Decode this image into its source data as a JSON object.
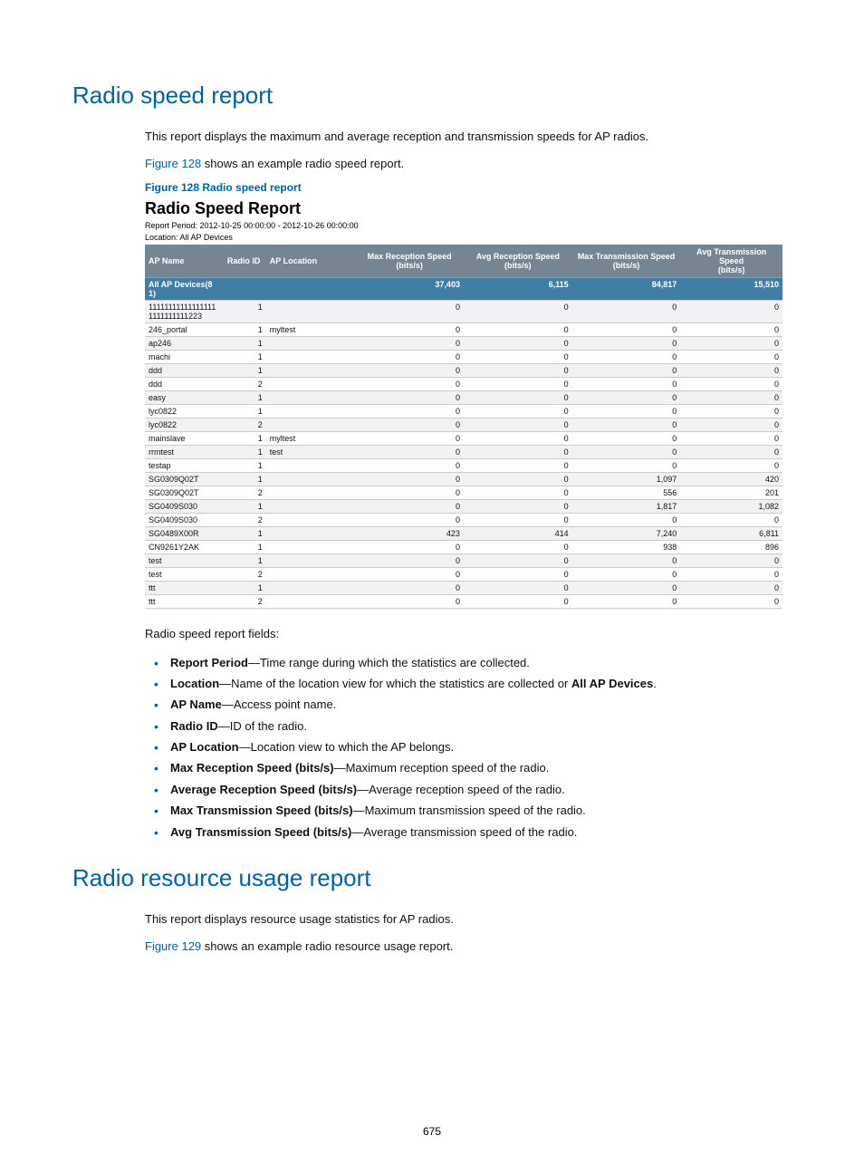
{
  "section1": {
    "title": "Radio speed report",
    "intro": "This report displays the maximum and average reception and transmission speeds for AP radios.",
    "figref": "Figure 128",
    "figref_rest": " shows an example radio speed report.",
    "figcaption": "Figure 128 Radio speed report",
    "reportTitle": "Radio Speed Report",
    "reportPeriod": "Report Period: 2012-10-25 00:00:00  -  2012-10-26 00:00:00",
    "location": "Location: All AP Devices"
  },
  "section2": {
    "title": "Radio resource usage report",
    "intro": "This report displays resource usage statistics for AP radios.",
    "figref": "Figure 129",
    "figref_rest": " shows an example radio resource usage report."
  },
  "fieldsHeading": "Radio speed report fields:",
  "fields": [
    {
      "term": "Report Period",
      "desc": "—Time range during which the statistics are collected."
    },
    {
      "term": "Location",
      "desc": "—Name of the location view for which the statistics are collected or ",
      "bold2": "All AP Devices",
      "tail": "."
    },
    {
      "term": "AP Name",
      "desc": "—Access point name."
    },
    {
      "term": "Radio ID",
      "desc": "—ID of the radio."
    },
    {
      "term": "AP Location",
      "desc": "—Location view to which the AP belongs."
    },
    {
      "term": "Max Reception Speed (bits/s)",
      "desc": "—Maximum reception speed of the radio."
    },
    {
      "term": "Average Reception Speed (bits/s)",
      "desc": "—Average reception speed of the radio."
    },
    {
      "term": "Max Transmission Speed (bits/s)",
      "desc": "—Maximum transmission speed of the radio."
    },
    {
      "term": "Avg Transmission Speed (bits/s)",
      "desc": "—Average transmission speed of the radio."
    }
  ],
  "pageNumber": "675",
  "chart_data": {
    "type": "table",
    "columns": [
      {
        "key": "ap_name",
        "label": "AP Name",
        "align": "l",
        "width": "12%"
      },
      {
        "key": "radio_id",
        "label": "Radio ID",
        "align": "r",
        "width": "7%"
      },
      {
        "key": "ap_location",
        "label": "AP Location",
        "align": "l",
        "width": "14%"
      },
      {
        "key": "max_rx",
        "label": "Max Reception Speed (bits/s)",
        "align": "r",
        "width": "17%"
      },
      {
        "key": "avg_rx",
        "label": "Avg Reception Speed (bits/s)",
        "align": "r",
        "width": "17%"
      },
      {
        "key": "max_tx",
        "label": "Max Transmission Speed (bits/s)",
        "align": "r",
        "width": "17%"
      },
      {
        "key": "avg_tx",
        "label": "Avg Transmission Speed (bits/s)",
        "align": "r",
        "width": "16%"
      }
    ],
    "summary": {
      "ap_name": "All AP Devices(81)",
      "radio_id": "",
      "ap_location": "",
      "max_rx": "37,403",
      "avg_rx": "6,115",
      "max_tx": "84,817",
      "avg_tx": "15,510"
    },
    "rows": [
      {
        "ap_name": "111111111111111111111111111223",
        "radio_id": "1",
        "ap_location": "",
        "max_rx": "0",
        "avg_rx": "0",
        "max_tx": "0",
        "avg_tx": "0"
      },
      {
        "ap_name": "246_portal",
        "radio_id": "1",
        "ap_location": "myltest",
        "max_rx": "0",
        "avg_rx": "0",
        "max_tx": "0",
        "avg_tx": "0"
      },
      {
        "ap_name": "ap246",
        "radio_id": "1",
        "ap_location": "",
        "max_rx": "0",
        "avg_rx": "0",
        "max_tx": "0",
        "avg_tx": "0"
      },
      {
        "ap_name": "machi",
        "radio_id": "1",
        "ap_location": "",
        "max_rx": "0",
        "avg_rx": "0",
        "max_tx": "0",
        "avg_tx": "0"
      },
      {
        "ap_name": "ddd",
        "radio_id": "1",
        "ap_location": "",
        "max_rx": "0",
        "avg_rx": "0",
        "max_tx": "0",
        "avg_tx": "0"
      },
      {
        "ap_name": "ddd",
        "radio_id": "2",
        "ap_location": "",
        "max_rx": "0",
        "avg_rx": "0",
        "max_tx": "0",
        "avg_tx": "0"
      },
      {
        "ap_name": "easy",
        "radio_id": "1",
        "ap_location": "",
        "max_rx": "0",
        "avg_rx": "0",
        "max_tx": "0",
        "avg_tx": "0"
      },
      {
        "ap_name": "lyc0822",
        "radio_id": "1",
        "ap_location": "",
        "max_rx": "0",
        "avg_rx": "0",
        "max_tx": "0",
        "avg_tx": "0"
      },
      {
        "ap_name": "lyc0822",
        "radio_id": "2",
        "ap_location": "",
        "max_rx": "0",
        "avg_rx": "0",
        "max_tx": "0",
        "avg_tx": "0"
      },
      {
        "ap_name": "mainslave",
        "radio_id": "1",
        "ap_location": "myltest",
        "max_rx": "0",
        "avg_rx": "0",
        "max_tx": "0",
        "avg_tx": "0"
      },
      {
        "ap_name": "rrmtest",
        "radio_id": "1",
        "ap_location": "test",
        "max_rx": "0",
        "avg_rx": "0",
        "max_tx": "0",
        "avg_tx": "0"
      },
      {
        "ap_name": "testap",
        "radio_id": "1",
        "ap_location": "",
        "max_rx": "0",
        "avg_rx": "0",
        "max_tx": "0",
        "avg_tx": "0"
      },
      {
        "ap_name": "SG0309Q02T",
        "radio_id": "1",
        "ap_location": "",
        "max_rx": "0",
        "avg_rx": "0",
        "max_tx": "1,097",
        "avg_tx": "420"
      },
      {
        "ap_name": "SG0309Q02T",
        "radio_id": "2",
        "ap_location": "",
        "max_rx": "0",
        "avg_rx": "0",
        "max_tx": "556",
        "avg_tx": "201"
      },
      {
        "ap_name": "SG0409S030",
        "radio_id": "1",
        "ap_location": "",
        "max_rx": "0",
        "avg_rx": "0",
        "max_tx": "1,817",
        "avg_tx": "1,082"
      },
      {
        "ap_name": "SG0409S030",
        "radio_id": "2",
        "ap_location": "",
        "max_rx": "0",
        "avg_rx": "0",
        "max_tx": "0",
        "avg_tx": "0"
      },
      {
        "ap_name": "SG0489X00R",
        "radio_id": "1",
        "ap_location": "",
        "max_rx": "423",
        "avg_rx": "414",
        "max_tx": "7,240",
        "avg_tx": "6,811"
      },
      {
        "ap_name": "CN9261Y2AK",
        "radio_id": "1",
        "ap_location": "",
        "max_rx": "0",
        "avg_rx": "0",
        "max_tx": "938",
        "avg_tx": "896"
      },
      {
        "ap_name": "test",
        "radio_id": "1",
        "ap_location": "",
        "max_rx": "0",
        "avg_rx": "0",
        "max_tx": "0",
        "avg_tx": "0"
      },
      {
        "ap_name": "test",
        "radio_id": "2",
        "ap_location": "",
        "max_rx": "0",
        "avg_rx": "0",
        "max_tx": "0",
        "avg_tx": "0"
      },
      {
        "ap_name": "ttt",
        "radio_id": "1",
        "ap_location": "",
        "max_rx": "0",
        "avg_rx": "0",
        "max_tx": "0",
        "avg_tx": "0"
      },
      {
        "ap_name": "ttt",
        "radio_id": "2",
        "ap_location": "",
        "max_rx": "0",
        "avg_rx": "0",
        "max_tx": "0",
        "avg_tx": "0"
      }
    ]
  }
}
